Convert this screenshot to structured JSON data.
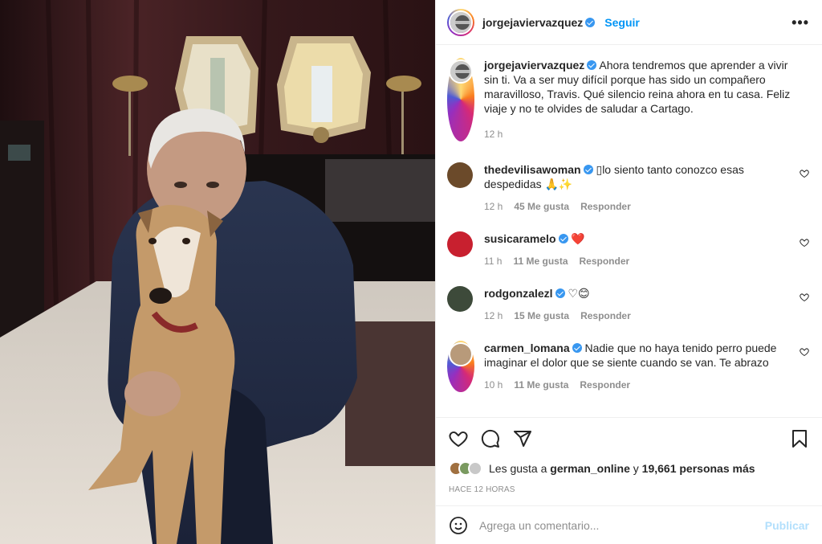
{
  "post": {
    "author": "jorgejaviervazquez",
    "follow_label": "Seguir",
    "more_label": "•••",
    "caption": "Ahora tendremos que aprender a vivir sin ti. Va a ser muy difícil porque has sido un compañero maravilloso, Travis. Qué silencio reina ahora en tu casa. Feliz viaje y no te olvides de saludar a Cartago.",
    "caption_time": "12 h",
    "image_alt": "Hombre de pelo blanco abrazando a un galgo"
  },
  "comments": [
    {
      "user": "thedevilisawoman",
      "verified": true,
      "text": "▯lo siento tanto conozco esas despedidas 🙏✨",
      "time": "12 h",
      "likes": "45 Me gusta",
      "reply": "Responder",
      "avatar_color": "#6b4a2a"
    },
    {
      "user": "susicaramelo",
      "verified": true,
      "text": "❤️",
      "time": "11 h",
      "likes": "11 Me gusta",
      "reply": "Responder",
      "avatar_color": "#c8202f"
    },
    {
      "user": "rodgonzalezl",
      "verified": true,
      "text": "♡😊",
      "time": "12 h",
      "likes": "15 Me gusta",
      "reply": "Responder",
      "avatar_color": "#3d4a3a"
    },
    {
      "user": "carmen_lomana",
      "verified": true,
      "text": "Nadie que no haya tenido perro puede imaginar el dolor que se siente cuando se van. Te abrazo",
      "time": "10 h",
      "likes": "11 Me gusta",
      "reply": "Responder",
      "avatar_color": "#b89a7a"
    }
  ],
  "likes_line": {
    "prefix": "Les gusta a",
    "user": "german_online",
    "and": "y",
    "count": "19,661 personas más"
  },
  "timestamp": "HACE 12 HORAS",
  "add_comment": {
    "placeholder": "Agrega un comentario...",
    "publish_label": "Publicar"
  },
  "colors": {
    "link": "#0095f6",
    "muted": "#8e8e8e",
    "verified": "#3897f0"
  }
}
